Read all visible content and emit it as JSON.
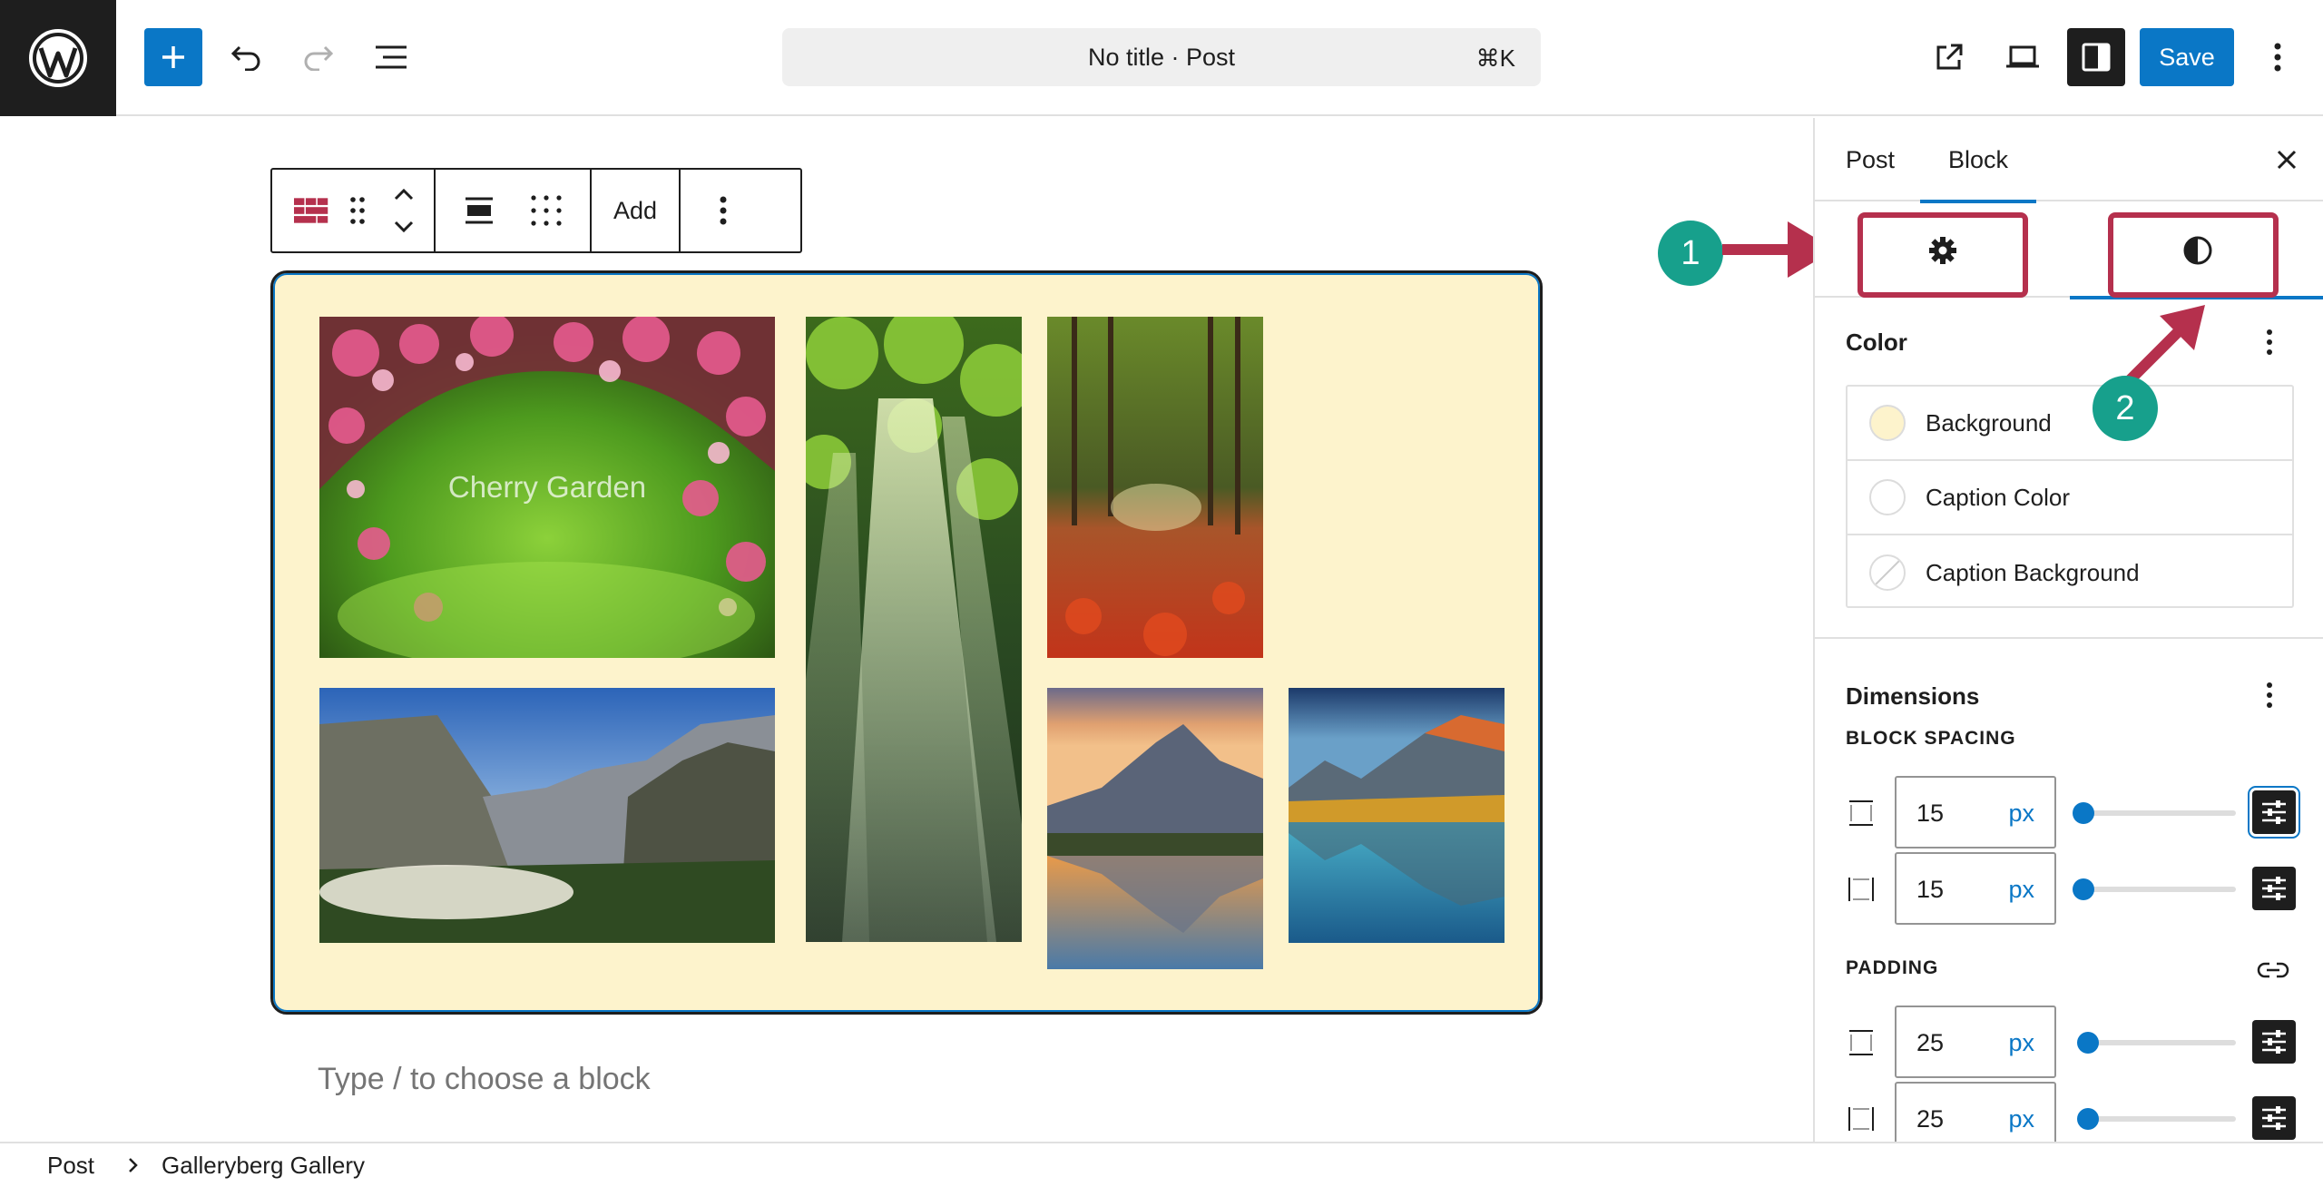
{
  "topbar": {
    "document_title": "No title · Post",
    "shortcut": "⌘K",
    "save_label": "Save",
    "icons": [
      "wordpress-logo-icon",
      "plus-icon",
      "undo-icon",
      "redo-icon",
      "list-view-icon",
      "external-link-icon",
      "desktop-icon",
      "sidebar-icon",
      "more-vertical-icon"
    ]
  },
  "block_toolbar": {
    "add_label": "Add",
    "icons": [
      "gallery-grid-icon",
      "drag-handle-icon",
      "move-up-down-icon",
      "align-icon",
      "grid-dots-icon",
      "more-vertical-icon"
    ]
  },
  "gallery": {
    "background_color": "#fdf3cc",
    "caption": "Cherry Garden",
    "images": [
      "cherry-blossom-photo",
      "forest-sunbeams-photo",
      "autumn-forest-path-photo",
      "yosemite-valley-photo",
      "mountain-lake-sunset-photo",
      "mountain-lake-reflection-photo"
    ]
  },
  "appender_placeholder": "Type / to choose a block",
  "sidebar": {
    "tabs": [
      "Post",
      "Block"
    ],
    "active_tab": "Block",
    "sub_tabs": [
      "settings",
      "styles"
    ],
    "color_panel": {
      "title": "Color",
      "items": [
        {
          "label": "Background",
          "swatch": "#fdf3cc"
        },
        {
          "label": "Caption Color",
          "swatch": "#ffffff"
        },
        {
          "label": "Caption Background",
          "swatch": "none"
        }
      ]
    },
    "dimensions_panel": {
      "title": "Dimensions",
      "block_spacing_label": "BLOCK SPACING",
      "padding_label": "PADDING",
      "block_spacing": [
        {
          "value": "15",
          "unit": "px",
          "slider": 0.0
        },
        {
          "value": "15",
          "unit": "px",
          "slider": 0.0
        }
      ],
      "padding": [
        {
          "value": "25",
          "unit": "px",
          "slider": 0.02
        },
        {
          "value": "25",
          "unit": "px",
          "slider": 0.02
        }
      ]
    }
  },
  "annotations": {
    "badge_1": "1",
    "badge_2": "2",
    "color": "#b5304d",
    "badge_color": "#17a08c"
  },
  "breadcrumb": [
    "Post",
    "Galleryberg Gallery"
  ],
  "colors": {
    "accent": "#0a77c6",
    "dark": "#1e1e1e"
  }
}
